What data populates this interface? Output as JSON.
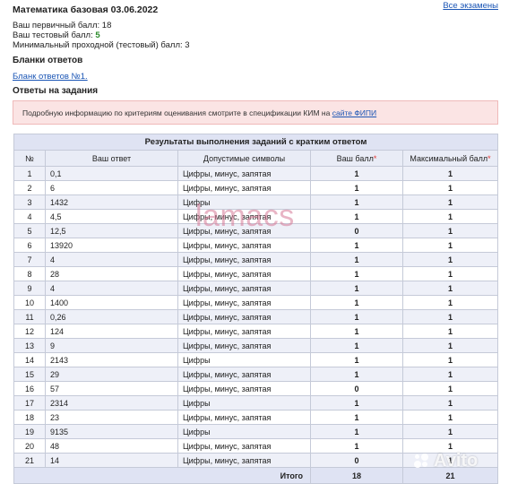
{
  "header": {
    "title": "Математика базовая 03.06.2022",
    "all_exams": "Все экзамены"
  },
  "info": {
    "primary_label": "Ваш первичный балл:",
    "primary_value": "18",
    "test_label": "Ваш тестовый балл:",
    "test_value": "5",
    "min_label": "Минимальный проходной (тестовый) балл:",
    "min_value": "3"
  },
  "forms": {
    "heading": "Бланки ответов",
    "link": "Бланк ответов №1."
  },
  "answers_heading": "Ответы на задания",
  "notice": {
    "text": "Подробную информацию по критериям оценивания смотрите в спецификации КИМ на",
    "link": "сайте ФИПИ"
  },
  "table": {
    "caption": "Результаты выполнения заданий с кратким ответом",
    "columns": [
      "№",
      "Ваш ответ",
      "Допустимые символы",
      "Ваш балл",
      "Максимальный балл"
    ],
    "star": "*",
    "rows": [
      [
        "1",
        "0,1",
        "Цифры, минус, запятая",
        "1",
        "1"
      ],
      [
        "2",
        "6",
        "Цифры, минус, запятая",
        "1",
        "1"
      ],
      [
        "3",
        "1432",
        "Цифры",
        "1",
        "1"
      ],
      [
        "4",
        "4,5",
        "Цифры, минус, запятая",
        "1",
        "1"
      ],
      [
        "5",
        "12,5",
        "Цифры, минус, запятая",
        "0",
        "1"
      ],
      [
        "6",
        "13920",
        "Цифры, минус, запятая",
        "1",
        "1"
      ],
      [
        "7",
        "4",
        "Цифры, минус, запятая",
        "1",
        "1"
      ],
      [
        "8",
        "28",
        "Цифры, минус, запятая",
        "1",
        "1"
      ],
      [
        "9",
        "4",
        "Цифры, минус, запятая",
        "1",
        "1"
      ],
      [
        "10",
        "1400",
        "Цифры, минус, запятая",
        "1",
        "1"
      ],
      [
        "11",
        "0,26",
        "Цифры, минус, запятая",
        "1",
        "1"
      ],
      [
        "12",
        "124",
        "Цифры, минус, запятая",
        "1",
        "1"
      ],
      [
        "13",
        "9",
        "Цифры, минус, запятая",
        "1",
        "1"
      ],
      [
        "14",
        "2143",
        "Цифры",
        "1",
        "1"
      ],
      [
        "15",
        "29",
        "Цифры, минус, запятая",
        "1",
        "1"
      ],
      [
        "16",
        "57",
        "Цифры, минус, запятая",
        "0",
        "1"
      ],
      [
        "17",
        "2314",
        "Цифры",
        "1",
        "1"
      ],
      [
        "18",
        "23",
        "Цифры, минус, запятая",
        "1",
        "1"
      ],
      [
        "19",
        "9135",
        "Цифры",
        "1",
        "1"
      ],
      [
        "20",
        "48",
        "Цифры, минус, запятая",
        "1",
        "1"
      ],
      [
        "21",
        "14",
        "Цифры, минус, запятая",
        "0",
        "1"
      ]
    ],
    "total_label": "Итого",
    "total_score": "18",
    "total_max": "21"
  },
  "watermark": "lamacs",
  "avito_logo": "Avito"
}
